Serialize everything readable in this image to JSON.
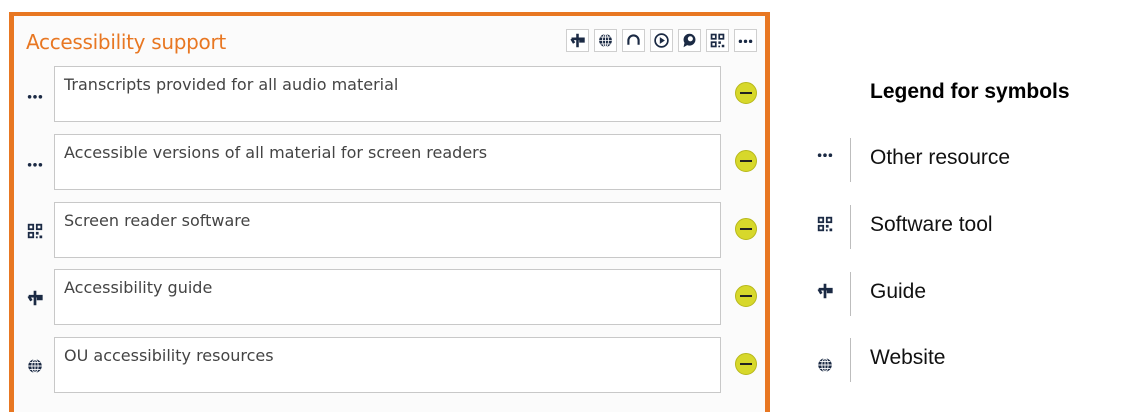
{
  "panel": {
    "title": "Accessibility support",
    "accent_color": "#e87722",
    "toolbar": [
      {
        "icon": "guide-icon",
        "name": "add-guide-button"
      },
      {
        "icon": "website-icon",
        "name": "add-website-button"
      },
      {
        "icon": "audio-icon",
        "name": "add-audio-button"
      },
      {
        "icon": "play-icon",
        "name": "add-video-button"
      },
      {
        "icon": "chat-icon",
        "name": "add-chat-button"
      },
      {
        "icon": "qr-icon",
        "name": "add-software-tool-button"
      },
      {
        "icon": "more-icon",
        "name": "add-other-resource-button"
      }
    ],
    "items": [
      {
        "icon": "more-icon",
        "text": "Transcripts provided for all audio material"
      },
      {
        "icon": "more-icon",
        "text": "Accessible versions of all material for screen readers"
      },
      {
        "icon": "qr-icon",
        "text": "Screen reader software"
      },
      {
        "icon": "guide-icon",
        "text": "Accessibility guide"
      },
      {
        "icon": "website-icon",
        "text": "OU accessibility resources"
      }
    ]
  },
  "legend": {
    "title": "Legend for symbols",
    "items": [
      {
        "icon": "more-icon",
        "label": "Other resource"
      },
      {
        "icon": "qr-icon",
        "label": "Software tool"
      },
      {
        "icon": "guide-icon",
        "label": "Guide"
      },
      {
        "icon": "website-icon",
        "label": "Website"
      }
    ]
  }
}
